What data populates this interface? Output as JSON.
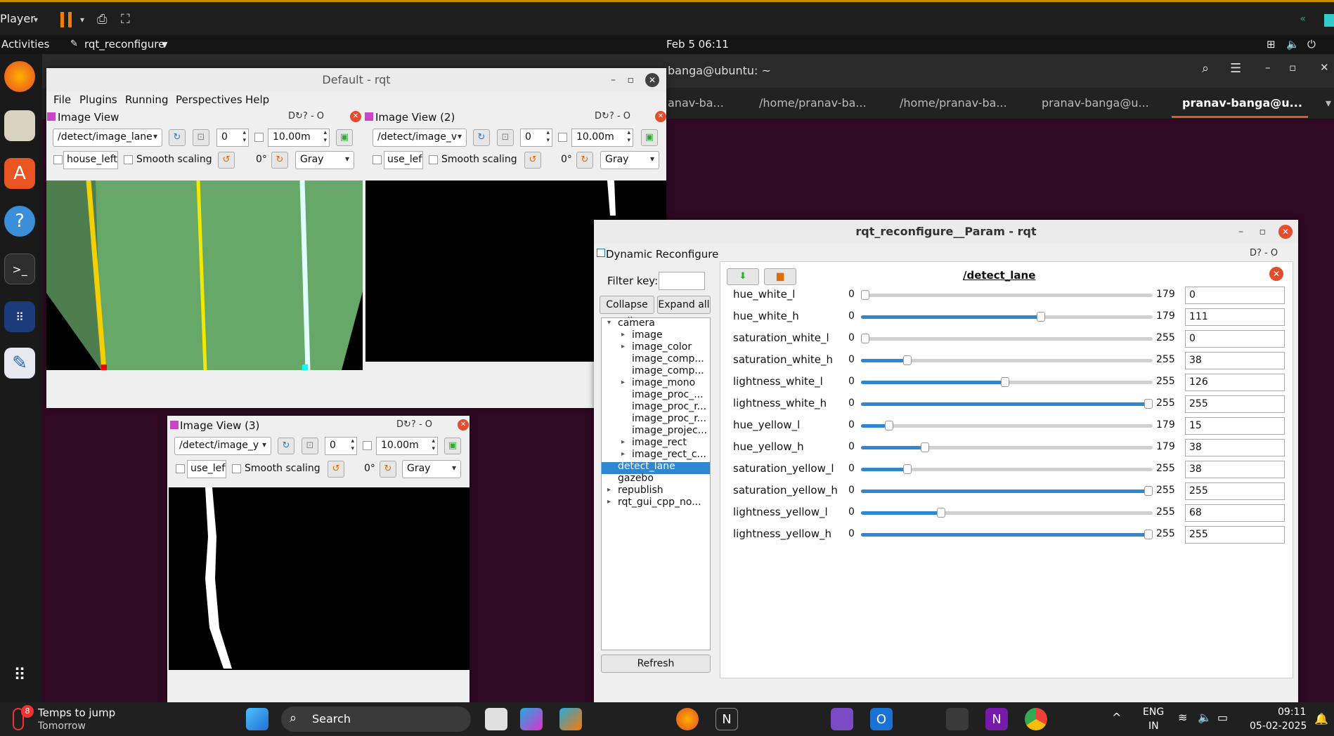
{
  "player_bar": {
    "label": "Player"
  },
  "top_bar": {
    "activities": "Activities",
    "app_name": "rqt_reconfigure",
    "clock": "Feb 5  06:11"
  },
  "terminal": {
    "title": "banga@ubuntu: ~",
    "tabs": [
      "anav-ba...",
      "/home/pranav-ba...",
      "/home/pranav-ba...",
      "pranav-banga@u...",
      "pranav-banga@u..."
    ]
  },
  "rqt_main": {
    "title": "Default - rqt",
    "menu": [
      "File",
      "Plugins",
      "Running",
      "Perspectives",
      "Help"
    ]
  },
  "image_view_1": {
    "title": "Image View",
    "topic": "/detect/image_lane",
    "spin_value": "0",
    "delay": "10.00m",
    "sub": "house_left",
    "smooth": "Smooth scaling",
    "rotation": "0°",
    "color": "Gray",
    "dock_label": "D"
  },
  "image_view_2": {
    "title": "Image View (2)",
    "topic": "/detect/image_v",
    "spin_value": "0",
    "delay": "10.00m",
    "sub": "use_left",
    "smooth": "Smooth scaling",
    "rotation": "0°",
    "color": "Gray",
    "dock_label": "D"
  },
  "image_view_3": {
    "title": "Image View (3)",
    "topic": "/detect/image_y",
    "spin_value": "0",
    "delay": "10.00m",
    "sub": "use_left",
    "smooth": "Smooth scaling",
    "rotation": "0°",
    "color": "Gray",
    "dock_label": "D"
  },
  "param_window": {
    "title": "rqt_reconfigure__Param - rqt",
    "plugin_title": "Dynamic Reconfigure",
    "dock_label": "D",
    "filter_label": "Filter key:",
    "filter_value": "",
    "collapse_all": "Collapse all",
    "expand_all": "Expand all",
    "refresh": "Refresh",
    "node_title": "/detect_lane",
    "tree": [
      {
        "label": "camera",
        "arrow": "▾"
      },
      {
        "label": "image",
        "arrow": "▸"
      },
      {
        "label": "image_color",
        "arrow": "▸"
      },
      {
        "label": "image_comp...",
        "arrow": ""
      },
      {
        "label": "image_comp...",
        "arrow": ""
      },
      {
        "label": "image_mono",
        "arrow": "▸"
      },
      {
        "label": "image_proc_...",
        "arrow": ""
      },
      {
        "label": "image_proc_r...",
        "arrow": ""
      },
      {
        "label": "image_proc_r...",
        "arrow": ""
      },
      {
        "label": "image_projec...",
        "arrow": ""
      },
      {
        "label": "image_rect",
        "arrow": "▸"
      },
      {
        "label": "image_rect_c...",
        "arrow": "▸"
      },
      {
        "label": "detect_lane",
        "arrow": ""
      },
      {
        "label": "gazebo",
        "arrow": ""
      },
      {
        "label": "republish",
        "arrow": "▸"
      },
      {
        "label": "rqt_gui_cpp_no...",
        "arrow": "▸"
      }
    ],
    "params": [
      {
        "name": "hue_white_l",
        "min": "0",
        "max": "179",
        "value": "0",
        "frac": 0.0
      },
      {
        "name": "hue_white_h",
        "min": "0",
        "max": "179",
        "value": "111",
        "frac": 0.62
      },
      {
        "name": "saturation_white_l",
        "min": "0",
        "max": "255",
        "value": "0",
        "frac": 0.0
      },
      {
        "name": "saturation_white_h",
        "min": "0",
        "max": "255",
        "value": "38",
        "frac": 0.149
      },
      {
        "name": "lightness_white_l",
        "min": "0",
        "max": "255",
        "value": "126",
        "frac": 0.494
      },
      {
        "name": "lightness_white_h",
        "min": "0",
        "max": "255",
        "value": "255",
        "frac": 1.0
      },
      {
        "name": "hue_yellow_l",
        "min": "0",
        "max": "179",
        "value": "15",
        "frac": 0.084
      },
      {
        "name": "hue_yellow_h",
        "min": "0",
        "max": "179",
        "value": "38",
        "frac": 0.212
      },
      {
        "name": "saturation_yellow_l",
        "min": "0",
        "max": "255",
        "value": "38",
        "frac": 0.149
      },
      {
        "name": "saturation_yellow_h",
        "min": "0",
        "max": "255",
        "value": "255",
        "frac": 1.0
      },
      {
        "name": "lightness_yellow_l",
        "min": "0",
        "max": "255",
        "value": "68",
        "frac": 0.267
      },
      {
        "name": "lightness_yellow_h",
        "min": "0",
        "max": "255",
        "value": "255",
        "frac": 1.0
      }
    ]
  },
  "taskbar": {
    "weather_title": "Temps to jump",
    "weather_sub": "Tomorrow",
    "weather_badge": "8",
    "search": "Search",
    "lang_top": "ENG",
    "lang_bottom": "IN",
    "time": "09:11",
    "date": "05-02-2025"
  }
}
